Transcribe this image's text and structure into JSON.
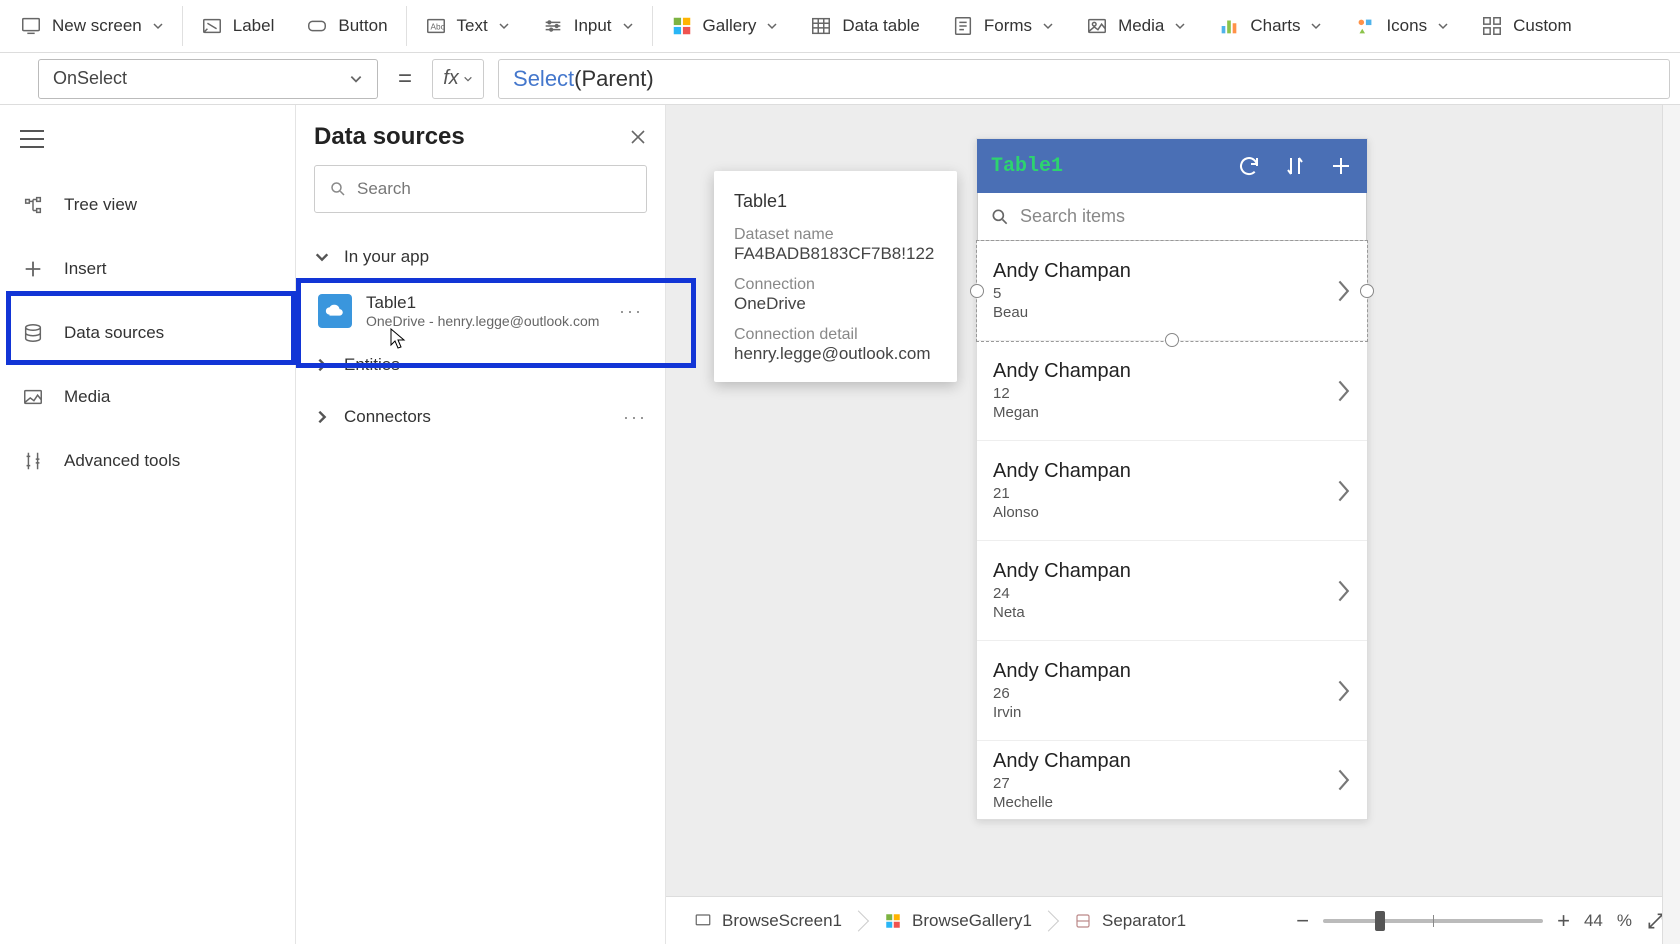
{
  "ribbon": {
    "new_screen": "New screen",
    "label": "Label",
    "button": "Button",
    "text": "Text",
    "input": "Input",
    "gallery": "Gallery",
    "data_table": "Data table",
    "forms": "Forms",
    "media": "Media",
    "charts": "Charts",
    "icons": "Icons",
    "custom": "Custom"
  },
  "formula": {
    "property": "OnSelect",
    "fx": "fx",
    "func": "Select",
    "arg": "Parent"
  },
  "rail": {
    "tree_view": "Tree view",
    "insert": "Insert",
    "data_sources": "Data sources",
    "media": "Media",
    "advanced": "Advanced tools"
  },
  "pane": {
    "title": "Data sources",
    "search_placeholder": "Search",
    "sections": {
      "in_your_app": "In your app",
      "entities": "Entities",
      "connectors": "Connectors"
    },
    "item": {
      "name": "Table1",
      "subtitle": "OneDrive - henry.legge@outlook.com"
    }
  },
  "tooltip": {
    "title": "Table1",
    "dataset_label": "Dataset name",
    "dataset_value": "FA4BADB8183CF7B8!122",
    "connection_label": "Connection",
    "connection_value": "OneDrive",
    "detail_label": "Connection detail",
    "detail_value": "henry.legge@outlook.com"
  },
  "app": {
    "title": "Table1",
    "search_placeholder": "Search items",
    "rows": [
      {
        "name": "Andy Champan",
        "num": "5",
        "sub": "Beau"
      },
      {
        "name": "Andy Champan",
        "num": "12",
        "sub": "Megan"
      },
      {
        "name": "Andy Champan",
        "num": "21",
        "sub": "Alonso"
      },
      {
        "name": "Andy Champan",
        "num": "24",
        "sub": "Neta"
      },
      {
        "name": "Andy Champan",
        "num": "26",
        "sub": "Irvin"
      },
      {
        "name": "Andy Champan",
        "num": "27",
        "sub": "Mechelle"
      }
    ]
  },
  "status": {
    "crumbs": [
      "BrowseScreen1",
      "BrowseGallery1",
      "Separator1"
    ],
    "zoom_value": "44",
    "zoom_pct": "%"
  }
}
